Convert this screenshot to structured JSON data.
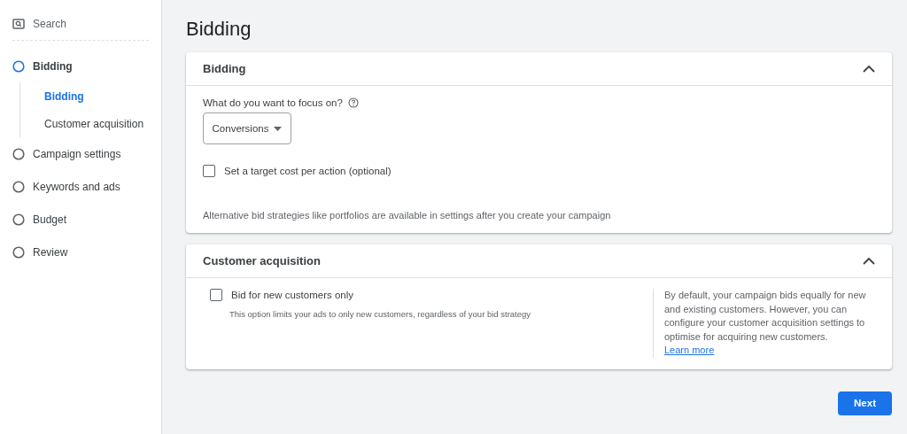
{
  "sidebar": {
    "search": {
      "label": "Search"
    },
    "steps": [
      {
        "label": "Bidding",
        "selected": true,
        "children": [
          {
            "label": "Bidding",
            "selected": true
          },
          {
            "label": "Customer acquisition",
            "selected": false
          }
        ]
      },
      {
        "label": "Campaign settings",
        "selected": false
      },
      {
        "label": "Keywords and ads",
        "selected": false
      },
      {
        "label": "Budget",
        "selected": false
      },
      {
        "label": "Review",
        "selected": false
      }
    ]
  },
  "page_title": "Bidding",
  "bidding_card": {
    "title": "Bidding",
    "expanded": true,
    "question": "What do you want to focus on?",
    "dropdown": {
      "value": "Conversions"
    },
    "checkbox": {
      "label": "Set a target cost per action (optional)",
      "checked": false
    },
    "note": "Alternative bid strategies like portfolios are available in settings after you create your campaign"
  },
  "acquisition_card": {
    "title": "Customer acquisition",
    "expanded": true,
    "checkbox": {
      "label": "Bid for new customers only",
      "checked": false
    },
    "hint": "This option limits your ads to only new customers, regardless of your bid strategy",
    "info_text": "By default, your campaign bids equally for new and existing customers. However, you can configure your customer acquisition settings to optimise for acquiring new customers.",
    "info_link": "Learn more"
  },
  "next_button": "Next"
}
